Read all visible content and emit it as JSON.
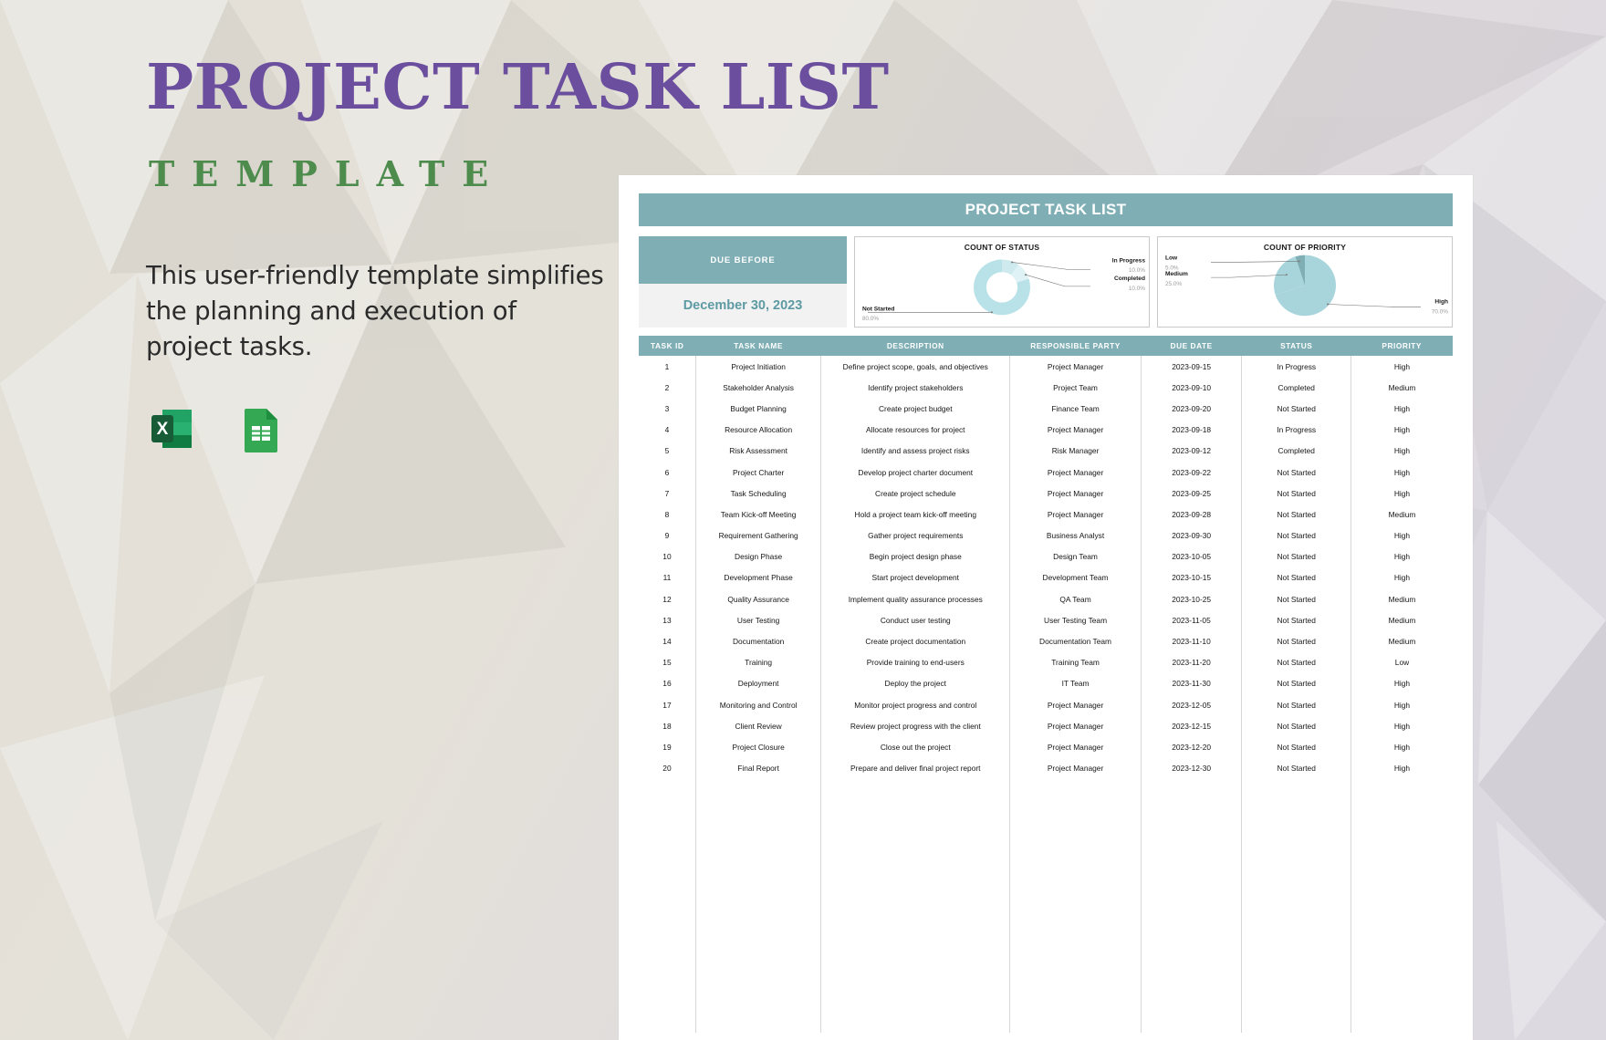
{
  "promo": {
    "title": "PROJECT TASK LIST",
    "subtitle": "TEMPLATE",
    "description": "This user-friendly template simplifies the planning and execution of project tasks.",
    "format_icons": [
      "excel-icon",
      "google-sheets-icon"
    ],
    "colors": {
      "title": "#6b4f9e",
      "subtitle": "#4e8c4e",
      "background": "#e2dfd9"
    }
  },
  "document": {
    "banner_title": "PROJECT TASK LIST",
    "accent_color": "#7fafb5",
    "due_before": {
      "label": "DUE BEFORE",
      "value": "December 30, 2023"
    },
    "table": {
      "columns": [
        "TASK ID",
        "TASK NAME",
        "DESCRIPTION",
        "RESPONSIBLE PARTY",
        "DUE DATE",
        "STATUS",
        "PRIORITY"
      ],
      "rows": [
        [
          "1",
          "Project Initiation",
          "Define project scope, goals, and objectives",
          "Project Manager",
          "2023-09-15",
          "In Progress",
          "High"
        ],
        [
          "2",
          "Stakeholder Analysis",
          "Identify project stakeholders",
          "Project Team",
          "2023-09-10",
          "Completed",
          "Medium"
        ],
        [
          "3",
          "Budget Planning",
          "Create project budget",
          "Finance Team",
          "2023-09-20",
          "Not Started",
          "High"
        ],
        [
          "4",
          "Resource Allocation",
          "Allocate resources for project",
          "Project Manager",
          "2023-09-18",
          "In Progress",
          "High"
        ],
        [
          "5",
          "Risk Assessment",
          "Identify and assess project risks",
          "Risk Manager",
          "2023-09-12",
          "Completed",
          "High"
        ],
        [
          "6",
          "Project Charter",
          "Develop project charter document",
          "Project Manager",
          "2023-09-22",
          "Not Started",
          "High"
        ],
        [
          "7",
          "Task Scheduling",
          "Create project schedule",
          "Project Manager",
          "2023-09-25",
          "Not Started",
          "High"
        ],
        [
          "8",
          "Team Kick-off Meeting",
          "Hold a project team kick-off meeting",
          "Project Manager",
          "2023-09-28",
          "Not Started",
          "Medium"
        ],
        [
          "9",
          "Requirement Gathering",
          "Gather project requirements",
          "Business Analyst",
          "2023-09-30",
          "Not Started",
          "High"
        ],
        [
          "10",
          "Design Phase",
          "Begin project design phase",
          "Design Team",
          "2023-10-05",
          "Not Started",
          "High"
        ],
        [
          "11",
          "Development Phase",
          "Start project development",
          "Development Team",
          "2023-10-15",
          "Not Started",
          "High"
        ],
        [
          "12",
          "Quality Assurance",
          "Implement quality assurance processes",
          "QA Team",
          "2023-10-25",
          "Not Started",
          "Medium"
        ],
        [
          "13",
          "User Testing",
          "Conduct user testing",
          "User Testing Team",
          "2023-11-05",
          "Not Started",
          "Medium"
        ],
        [
          "14",
          "Documentation",
          "Create project documentation",
          "Documentation Team",
          "2023-11-10",
          "Not Started",
          "Medium"
        ],
        [
          "15",
          "Training",
          "Provide training to end-users",
          "Training Team",
          "2023-11-20",
          "Not Started",
          "Low"
        ],
        [
          "16",
          "Deployment",
          "Deploy the project",
          "IT Team",
          "2023-11-30",
          "Not Started",
          "High"
        ],
        [
          "17",
          "Monitoring and Control",
          "Monitor project progress and control",
          "Project Manager",
          "2023-12-05",
          "Not Started",
          "High"
        ],
        [
          "18",
          "Client Review",
          "Review project progress with the client",
          "Project Manager",
          "2023-12-15",
          "Not Started",
          "High"
        ],
        [
          "19",
          "Project Closure",
          "Close out the project",
          "Project Manager",
          "2023-12-20",
          "Not Started",
          "High"
        ],
        [
          "20",
          "Final Report",
          "Prepare and deliver final project report",
          "Project Manager",
          "2023-12-30",
          "Not Started",
          "High"
        ]
      ],
      "empty_row_count": 12
    }
  },
  "chart_data": [
    {
      "type": "pie",
      "variant": "donut",
      "title": "COUNT OF STATUS",
      "labels": [
        "Not Started",
        "In Progress",
        "Completed"
      ],
      "values": [
        80.0,
        10.0,
        10.0
      ],
      "value_labels": [
        "80.0%",
        "10.0%",
        "10.0%"
      ],
      "colors": [
        "#b8e2e8",
        "#dff2f5",
        "#cfeaef"
      ],
      "legend": "callout-labels",
      "grid": false
    },
    {
      "type": "pie",
      "title": "COUNT OF PRIORITY",
      "labels": [
        "High",
        "Medium",
        "Low"
      ],
      "values": [
        70.0,
        25.0,
        5.0
      ],
      "value_labels": [
        "70.0%",
        "25.0%",
        "5.0%"
      ],
      "colors": [
        "#a8d5dc",
        "#a8d5dc",
        "#7fafb5"
      ],
      "legend": "callout-labels",
      "grid": false
    }
  ]
}
